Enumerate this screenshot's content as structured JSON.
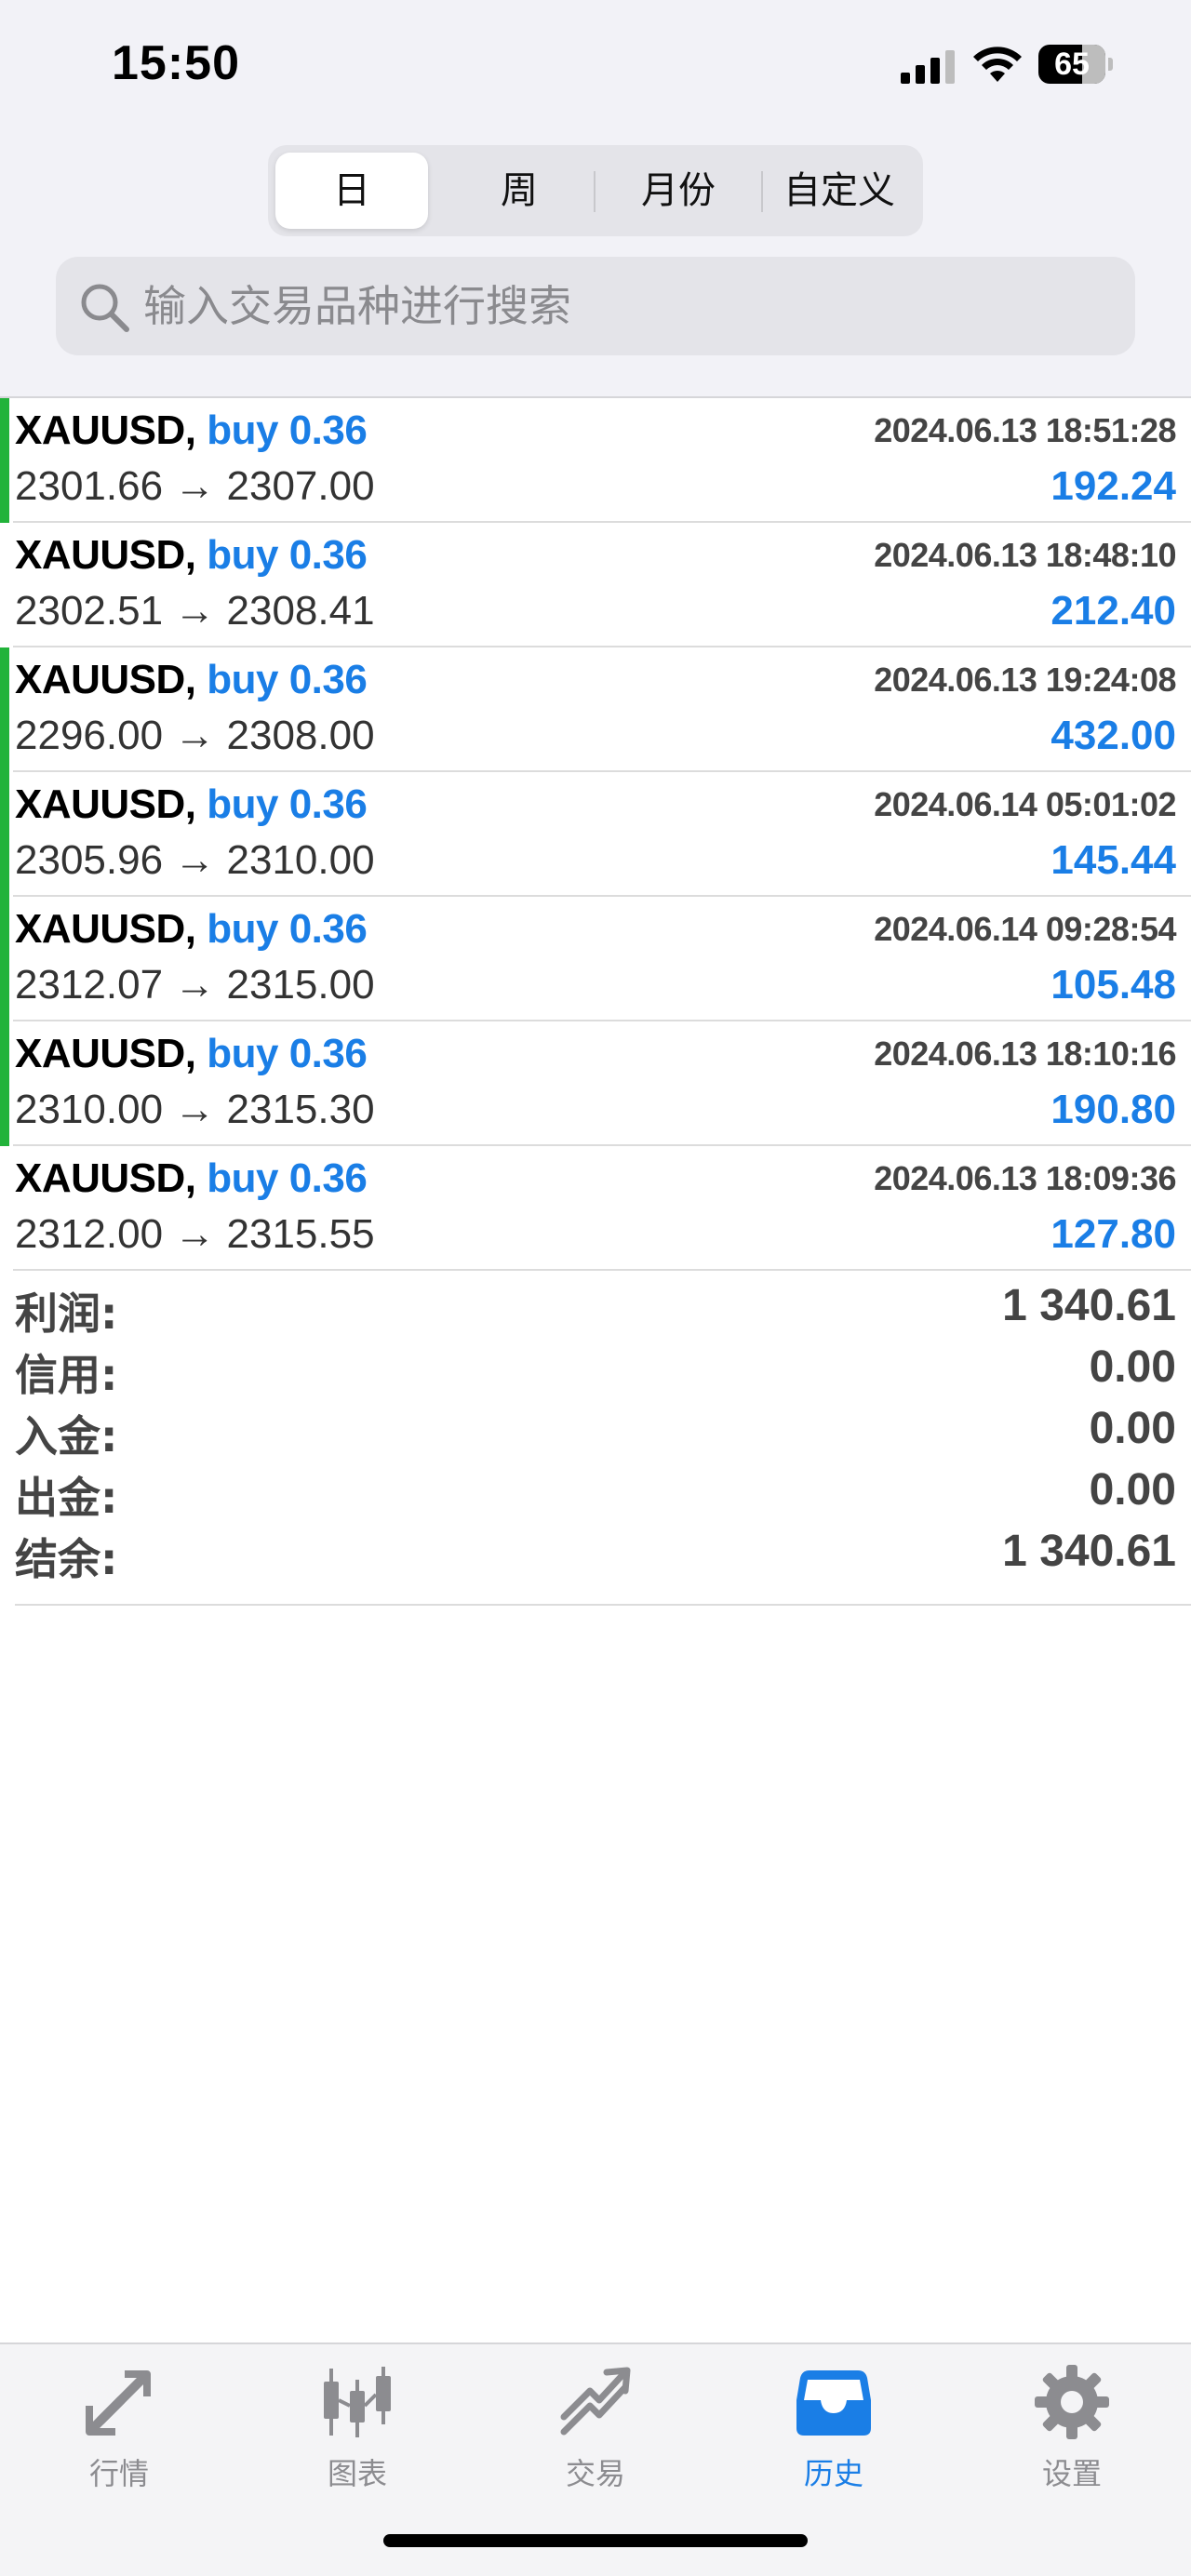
{
  "status_bar": {
    "time": "15:50",
    "battery": "65"
  },
  "segments": [
    {
      "label": "日",
      "active": true
    },
    {
      "label": "周",
      "active": false
    },
    {
      "label": "月份",
      "active": false
    },
    {
      "label": "自定义",
      "active": false
    }
  ],
  "search": {
    "placeholder": "输入交易品种进行搜索",
    "value": ""
  },
  "trades": [
    {
      "symbol": "XAUUSD,",
      "direction": "buy 0.36",
      "time": "2024.06.13 18:51:28",
      "prices": "2301.66 → 2307.00",
      "profit": "192.24",
      "bar": true
    },
    {
      "symbol": "XAUUSD,",
      "direction": "buy 0.36",
      "time": "2024.06.13 18:48:10",
      "prices": "2302.51 → 2308.41",
      "profit": "212.40",
      "bar": false
    },
    {
      "symbol": "XAUUSD,",
      "direction": "buy 0.36",
      "time": "2024.06.13 19:24:08",
      "prices": "2296.00 → 2308.00",
      "profit": "432.00",
      "bar": true
    },
    {
      "symbol": "XAUUSD,",
      "direction": "buy 0.36",
      "time": "2024.06.14 05:01:02",
      "prices": "2305.96 → 2310.00",
      "profit": "145.44",
      "bar": true
    },
    {
      "symbol": "XAUUSD,",
      "direction": "buy 0.36",
      "time": "2024.06.14 09:28:54",
      "prices": "2312.07 → 2315.00",
      "profit": "105.48",
      "bar": true
    },
    {
      "symbol": "XAUUSD,",
      "direction": "buy 0.36",
      "time": "2024.06.13 18:10:16",
      "prices": "2310.00 → 2315.30",
      "profit": "190.80",
      "bar": true
    },
    {
      "symbol": "XAUUSD,",
      "direction": "buy 0.36",
      "time": "2024.06.13 18:09:36",
      "prices": "2312.00 → 2315.55",
      "profit": "127.80",
      "bar": false
    }
  ],
  "summary": [
    {
      "label": "利润:",
      "value": "1 340.61"
    },
    {
      "label": "信用:",
      "value": "0.00"
    },
    {
      "label": "入金:",
      "value": "0.00"
    },
    {
      "label": "出金:",
      "value": "0.00"
    },
    {
      "label": "结余:",
      "value": "1 340.61"
    }
  ],
  "tabs": [
    {
      "label": "行情",
      "icon": "quotes-arrows-icon",
      "active": false
    },
    {
      "label": "图表",
      "icon": "candlestick-chart-icon",
      "active": false
    },
    {
      "label": "交易",
      "icon": "trade-trend-icon",
      "active": false
    },
    {
      "label": "历史",
      "icon": "history-inbox-icon",
      "active": true
    },
    {
      "label": "设置",
      "icon": "gear-icon",
      "active": false
    }
  ],
  "colors": {
    "accent": "#1a7ee6",
    "bar_green": "#22b33a",
    "inactive_tab": "#8c8c90"
  }
}
